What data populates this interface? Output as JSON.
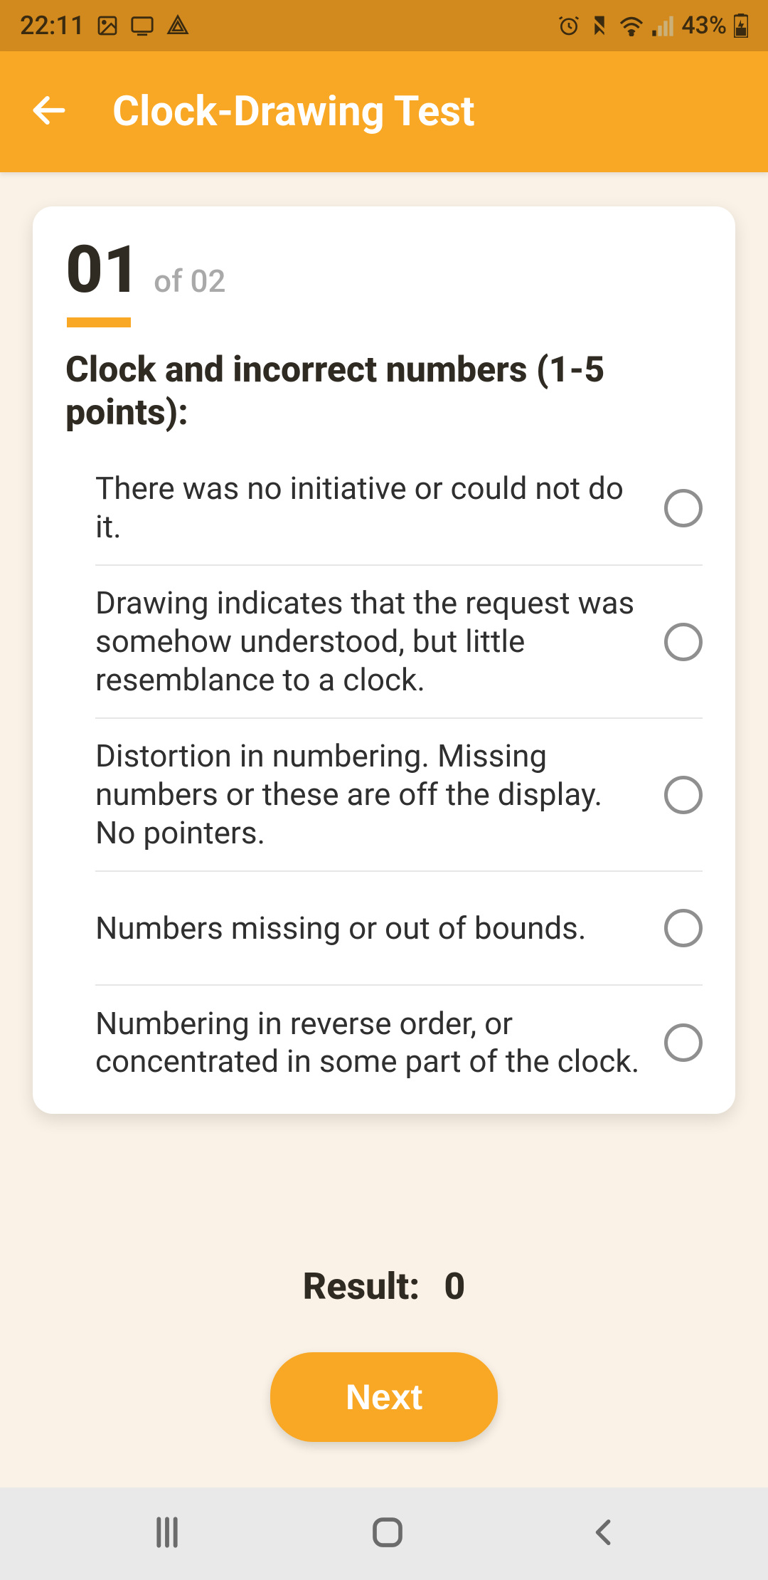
{
  "status": {
    "time": "22:11",
    "battery": "43%"
  },
  "appbar": {
    "title": "Clock-Drawing Test"
  },
  "question": {
    "number": "01",
    "total_label": "of 02",
    "title": "Clock and incorrect numbers (1-5 points):",
    "options": [
      "There was no initiative or could not do it.",
      "Drawing indicates that the request was somehow understood, but little resemblance to a clock.",
      "Distortion in numbering. Missing numbers or these are off the display. No pointers.",
      "Numbers missing or out of bounds.",
      "Numbering in reverse order, or concentrated in some part of the clock."
    ]
  },
  "result": {
    "label": "Result:",
    "value": "0"
  },
  "buttons": {
    "next": "Next"
  }
}
